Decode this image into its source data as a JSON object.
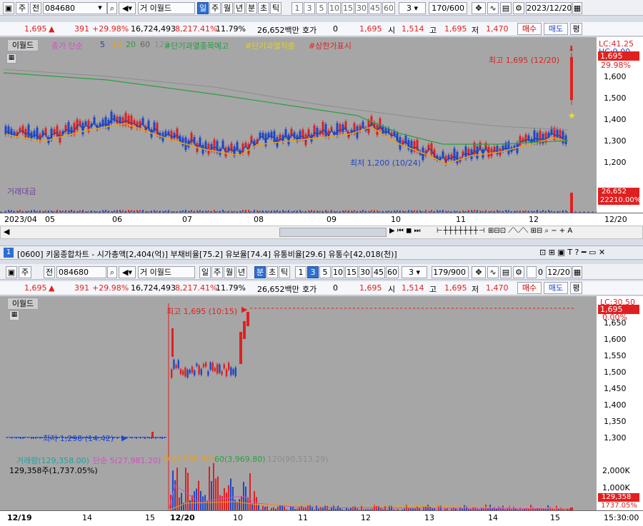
{
  "toolbar_top": {
    "type1": "주",
    "type2": "전",
    "code": "084680",
    "name_prefix": "거",
    "name": "이월드",
    "periods": [
      "일",
      "주",
      "월",
      "년",
      "분",
      "초",
      "틱"
    ],
    "period_selected": "일",
    "minutes": [
      "1",
      "3",
      "5",
      "10",
      "15",
      "30",
      "45",
      "60"
    ],
    "unit_select": "3",
    "count": "170/600",
    "date": "2023/12/20"
  },
  "quote": {
    "price": "1,695",
    "change": "391",
    "rate": "+29.98%",
    "volume": "16,724,493",
    "vol_ratio": "8,217.41%",
    "turnover": "11.79%",
    "amount": "26,652백만",
    "ask_label": "호가",
    "ask_value": "0",
    "price2": "1,695",
    "open_label": "시",
    "open": "1,514",
    "high_label": "고",
    "high": "1,695",
    "low_label": "저",
    "low": "1,470",
    "buy": "매수",
    "sell": "매도",
    "eval": "평"
  },
  "top_chart": {
    "stock_label": "이월드",
    "legend": {
      "ma_title": "종가 단순",
      "ma5": "5",
      "ma10": "10",
      "ma20": "20",
      "ma60": "60",
      "ma120": "120",
      "ind1": "#단기과열종목예고",
      "ind2": "#단기과열적출",
      "ind3": "#상한가표시"
    },
    "high_annotation": "최고 1,695 (12/20)",
    "low_annotation": "최저 1,200 (10/24)",
    "volume_label": "거래대금",
    "lc_label": "LC:41.25",
    "hc_label": "HC:9.00",
    "price_tag": "1,695",
    "rate_tag": "29.98%",
    "y_ticks": [
      "1,600",
      "1,500",
      "1,400",
      "1,300",
      "1,200"
    ],
    "vol_tag1": "26,652",
    "vol_tag2": "22210.00%",
    "x_labels": [
      "2023/04",
      "05",
      "06",
      "07",
      "08",
      "09",
      "10",
      "11",
      "12"
    ],
    "x_end": "12/20"
  },
  "window": {
    "number": "1",
    "title": "[0600] 키움종합차트 - 시가총액[2,404(억)] 부채비율[75.2] 유보율[74.4] 유통비율[29.6] 유통수[42,018(천)]"
  },
  "toolbar_bottom": {
    "type1": "주",
    "type2": "전",
    "code": "084680",
    "name_prefix": "거",
    "name": "이월드",
    "periods": [
      "일",
      "주",
      "월",
      "년",
      "분",
      "초",
      "틱"
    ],
    "period_selected": "분",
    "minutes": [
      "1",
      "3",
      "5",
      "10",
      "15",
      "30",
      "45",
      "60"
    ],
    "minute_selected": "3",
    "unit_select": "3",
    "count": "179/900",
    "check_value": "0",
    "date": "12/20"
  },
  "bottom_chart": {
    "stock_label": "이월드",
    "high_annotation": "최고 1,695 (10:15)",
    "low_annotation": "최저 1,298 (14:42)",
    "lc_label": "LC:30.50",
    "price_tag": "1,695",
    "rate_tag": "0.00%",
    "y_ticks": [
      "1,650",
      "1,600",
      "1,550",
      "1,500",
      "1,450",
      "1,400",
      "1,350",
      "1,300"
    ],
    "vol_legend": {
      "v1": "거래량(129,358.00)",
      "v2": "단순 5(27,981.20)",
      "v3": "20(7,965.30)",
      "v4": "60(3,969.80)",
      "v5": "120(90,513.29)"
    },
    "vol_value": "129,358주(1,737.05%)",
    "vol_ticks": [
      "2,000K",
      "1,000K"
    ],
    "vol_tag1": "129,358",
    "vol_tag2": "1737.05%",
    "x_labels": [
      "12/19",
      "14",
      "15",
      "12/20",
      "10",
      "11",
      "12",
      "13",
      "14",
      "15"
    ],
    "time_end": "15:30:00"
  },
  "colors": {
    "up": "#e02020",
    "down": "#1f47c8",
    "ma5": "#1f3fa8",
    "ma10": "#e8a020",
    "ma20": "#2aa040",
    "ma120": "#8c8c8c"
  }
}
